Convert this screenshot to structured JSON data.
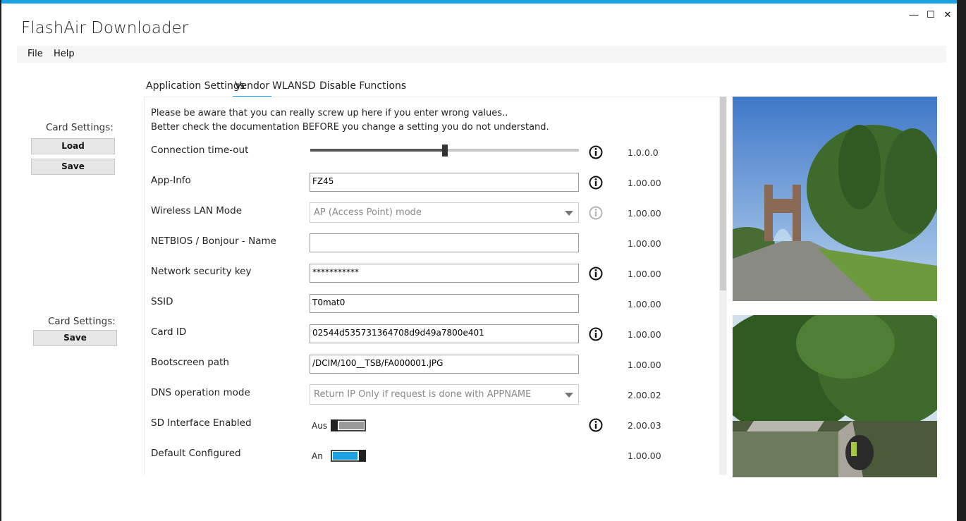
{
  "window": {
    "title": "FlashAir Downloader",
    "controls": {
      "minimize": "—",
      "maximize": "☐",
      "close": "✕"
    }
  },
  "menu": {
    "items": [
      "File",
      "Help"
    ]
  },
  "left": {
    "card_settings_1": "Card Settings:",
    "load_label": "Load",
    "save_label_1": "Save",
    "card_settings_2": "Card Settings:",
    "save_label_2": "Save"
  },
  "tabs": [
    "Application Settings",
    "Vendor",
    "WLANSD",
    "Disable Functions"
  ],
  "active_tab": "Vendor",
  "warning": {
    "line1": "Please be aware that you can really screw up here if you enter wrong values..",
    "line2": "Better check the documentation BEFORE you change a setting you do not understand."
  },
  "settings": [
    {
      "label": "Connection time-out",
      "control": "slider",
      "level": 0.5,
      "info": true,
      "version": "1.0.0.0"
    },
    {
      "label": "App-Info",
      "control": "text",
      "value": "FZ45",
      "info": true,
      "version": "1.00.00"
    },
    {
      "label": "Wireless LAN Mode",
      "control": "combo",
      "value": "AP (Access Point) mode",
      "info": true,
      "info_disabled": true,
      "version": "1.00.00"
    },
    {
      "label": "NETBIOS / Bonjour - Name",
      "control": "text",
      "value": "",
      "info": false,
      "version": "1.00.00"
    },
    {
      "label": "Network security key",
      "control": "text",
      "value": "***********",
      "info": true,
      "version": "1.00.00"
    },
    {
      "label": "SSID",
      "control": "text",
      "value": "T0mat0",
      "info": false,
      "version": "1.00.00"
    },
    {
      "label": "Card ID",
      "control": "text",
      "value": "02544d535731364708d9d49a7800e401",
      "info": true,
      "version": "1.00.00"
    },
    {
      "label": "Bootscreen path",
      "control": "text",
      "value": "/DCIM/100__TSB/FA000001.JPG",
      "info": false,
      "version": "1.00.00"
    },
    {
      "label": "DNS operation mode",
      "control": "combo",
      "value": "Return IP Only if request is done with APPNAME",
      "info": false,
      "version": "2.00.02"
    },
    {
      "label": "SD Interface Enabled",
      "control": "toggle",
      "state_label": "Aus",
      "on": false,
      "info": true,
      "version": "2.00.03"
    },
    {
      "label": "Default Configured",
      "control": "toggle",
      "state_label": "An",
      "on": true,
      "info": false,
      "version": "1.00.00"
    }
  ],
  "colors": {
    "accent": "#1ba1e2",
    "toggle_off": "#9a9a9a"
  },
  "photos": [
    "gate-bridge-photo",
    "lake-boardwalk-photo"
  ]
}
